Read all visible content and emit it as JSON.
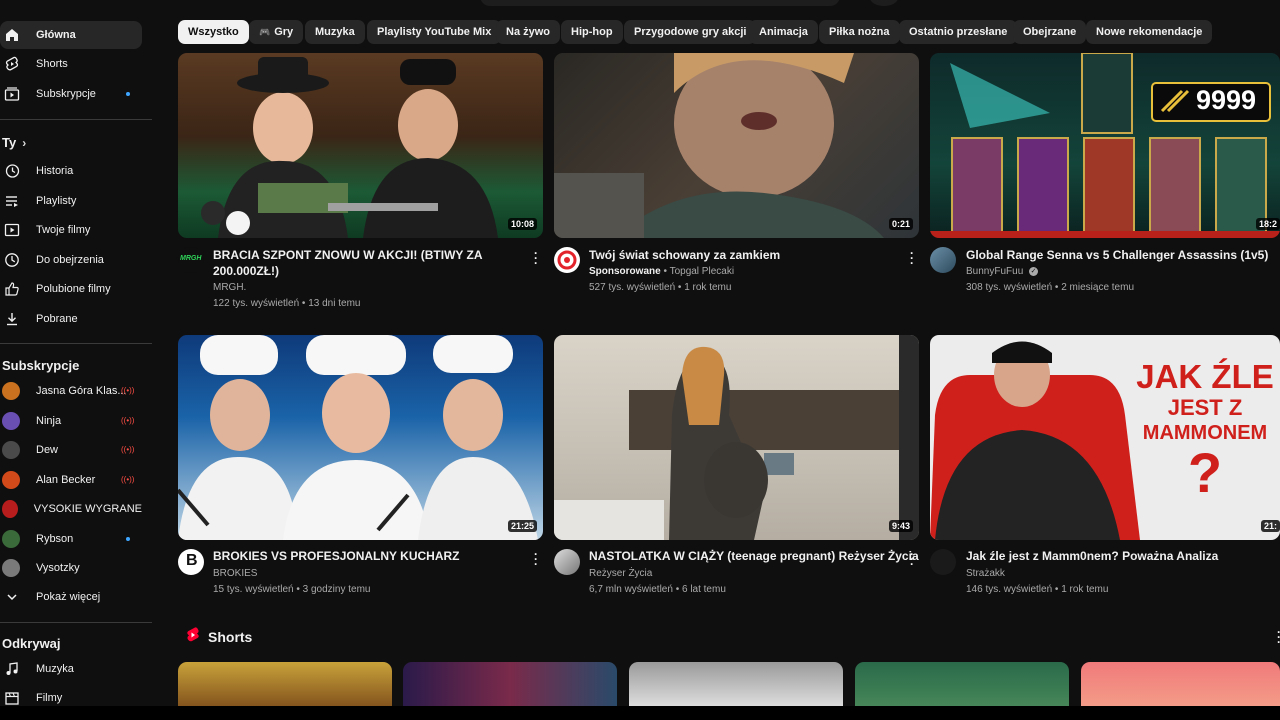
{
  "sidebar": {
    "main": [
      {
        "label": "Główna",
        "icon": "home-icon",
        "active": true
      },
      {
        "label": "Shorts",
        "icon": "shorts-icon"
      },
      {
        "label": "Subskrypcje",
        "icon": "subscriptions-icon",
        "dot": true
      }
    ],
    "you_header": "Ty",
    "you": [
      {
        "label": "Historia",
        "icon": "history-icon"
      },
      {
        "label": "Playlisty",
        "icon": "playlists-icon"
      },
      {
        "label": "Twoje filmy",
        "icon": "your-videos-icon"
      },
      {
        "label": "Do obejrzenia",
        "icon": "watch-later-icon"
      },
      {
        "label": "Polubione filmy",
        "icon": "liked-icon"
      },
      {
        "label": "Pobrane",
        "icon": "download-icon"
      }
    ],
    "subs_header": "Subskrypcje",
    "subs": [
      {
        "label": "Jasna Góra Klas...",
        "color": "#c9711f",
        "live": true
      },
      {
        "label": "Ninja",
        "color": "#6a4fb3",
        "live": true
      },
      {
        "label": "Dew",
        "color": "#4a4a4a",
        "live": true
      },
      {
        "label": "Alan Becker",
        "color": "#d24a1a",
        "live": true
      },
      {
        "label": "VYSOKIE WYGRANE",
        "color": "#b81d1d"
      },
      {
        "label": "Rybson",
        "color": "#3a6a3a",
        "dot": true
      },
      {
        "label": "Vysotzky",
        "color": "#7a7a7a"
      }
    ],
    "show_more": "Pokaż więcej",
    "explore_header": "Odkrywaj",
    "explore": [
      {
        "label": "Muzyka",
        "icon": "music-icon"
      },
      {
        "label": "Filmy",
        "icon": "movies-icon"
      }
    ],
    "live_glyph": "((•))"
  },
  "chips": [
    "Wszystko",
    "Gry",
    "Muzyka",
    "Playlisty YouTube Mix",
    "Na żywo",
    "Hip-hop",
    "Przygodowe gry akcji",
    "Animacja",
    "Piłka nożna",
    "Ostatnio przesłane",
    "Obejrzane",
    "Nowe rekomendacje"
  ],
  "videos": [
    {
      "title": "BRACIA SZPONT ZNOWU W AKCJI! (BTIWY ZA 200.000ZŁ!)",
      "channel": "MRGH.",
      "meta": "122 tys. wyświetleń • 13 dni temu",
      "duration": "10:08",
      "avatar_text": "MRGH"
    },
    {
      "title": "Twój świat schowany za zamkiem",
      "sponsored": "Sponsorowane",
      "channel": " • Topgal Plecaki",
      "meta": "527 tys. wyświetleń • 1 rok temu",
      "duration": "0:21"
    },
    {
      "title": "Global Range Senna vs 5 Challenger Assassins (1v5)",
      "channel": "BunnyFuFuu",
      "meta": "308 tys. wyświetleń • 2 miesiące temu",
      "duration": "18:2",
      "overlay": "9999"
    },
    {
      "title": "BROKIES VS PROFESJONALNY KUCHARZ",
      "channel": "BROKIES",
      "meta": "15 tys. wyświetleń • 3 godziny temu",
      "duration": "21:25",
      "avatar_text": "B"
    },
    {
      "title": "NASTOLATKA W CIĄŻY (teenage pregnant) Reżyser Życia",
      "channel": "Reżyser Życia",
      "meta": "6,7 mln wyświetleń • 6 lat temu",
      "duration": "9:43"
    },
    {
      "title": "Jak źle jest z Mamm0nem? Poważna Analiza",
      "channel": "Strażakk",
      "meta": "146 tys. wyświetleń • 1 rok temu",
      "duration": "21:",
      "overlay_lines": [
        "JAK ŹLE",
        "JEST Z",
        "MAMMONEM",
        "?"
      ]
    }
  ],
  "shorts_label": "Shorts"
}
